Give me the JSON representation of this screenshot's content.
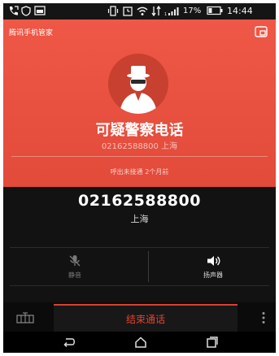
{
  "status_bar": {
    "battery": "17%",
    "time": "14:44"
  },
  "header": {
    "app_label": "腾讯手机管家"
  },
  "caller": {
    "title": "可疑警察电话",
    "number_and_location": "02162588800 上海",
    "call_record": "呼出未接通 2个月前"
  },
  "call_info": {
    "number": "02162588800",
    "location": "上海"
  },
  "actions": {
    "mute_label": "静音",
    "speaker_label": "扬声器"
  },
  "bottom_bar": {
    "end_call_label": "结束通话"
  },
  "icons": {
    "keypad": "dialpad-icon",
    "more": "more-vertical-icon",
    "back": "back-icon",
    "home": "home-icon",
    "recents": "recents-icon"
  },
  "colors": {
    "header_red": "#e9503f",
    "end_call_red": "#e4432f",
    "dark_bg": "#121212"
  }
}
